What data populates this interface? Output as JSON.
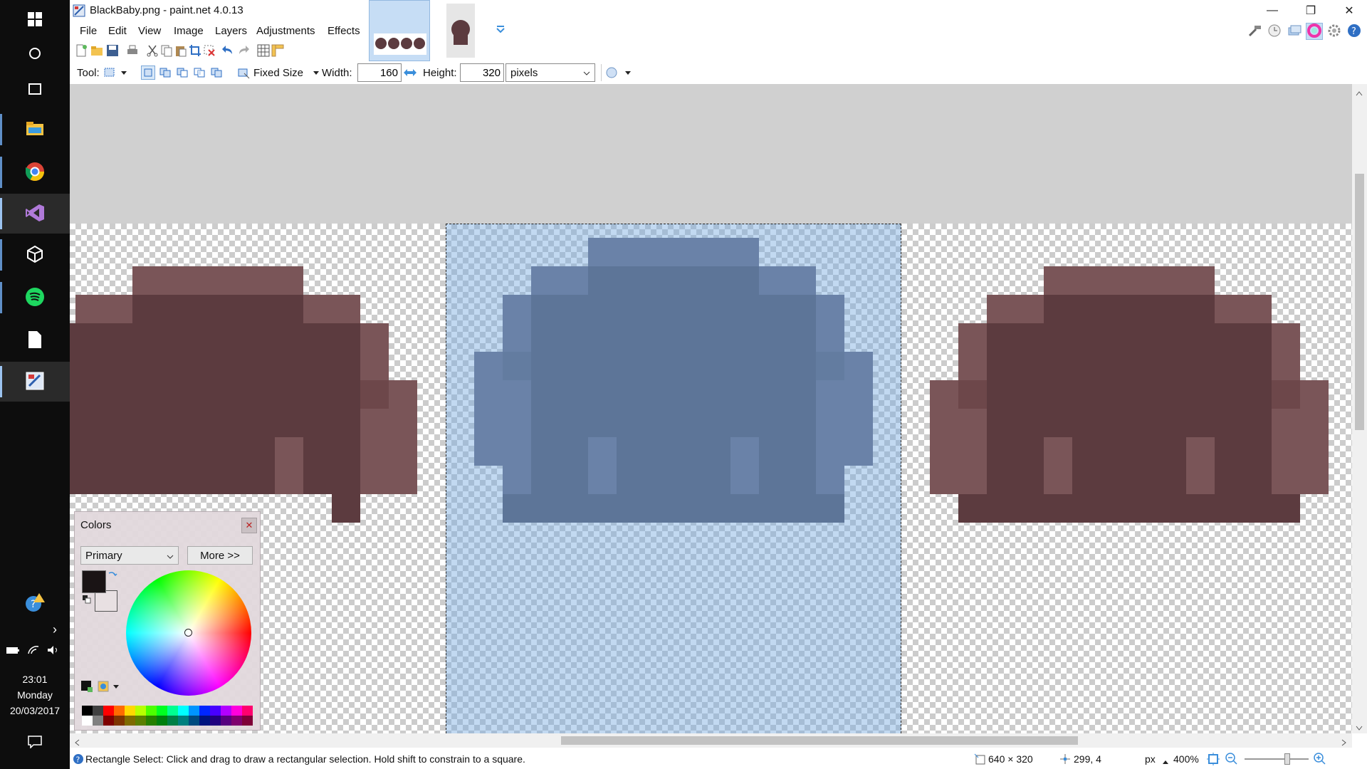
{
  "taskbar": {
    "items": [
      {
        "name": "windows-start",
        "icon": "windows-logo-icon"
      },
      {
        "name": "cortana",
        "icon": "cortana-circle-icon"
      },
      {
        "name": "task-view",
        "icon": "task-view-icon"
      },
      {
        "name": "file-explorer",
        "icon": "folder-icon"
      },
      {
        "name": "chrome",
        "icon": "chrome-icon"
      },
      {
        "name": "visual-studio",
        "icon": "visual-studio-icon"
      },
      {
        "name": "unity",
        "icon": "unity-icon"
      },
      {
        "name": "spotify",
        "icon": "spotify-icon"
      },
      {
        "name": "notepad",
        "icon": "document-icon"
      },
      {
        "name": "paint-net",
        "icon": "paint-net-icon"
      }
    ],
    "time": "23:01",
    "day": "Monday",
    "date": "20/03/2017"
  },
  "window": {
    "title": "BlackBaby.png - paint.net 4.0.13"
  },
  "menu": [
    "File",
    "Edit",
    "View",
    "Image",
    "Layers",
    "Adjustments",
    "Effects"
  ],
  "tool_options": {
    "tool_label": "Tool:",
    "fixed_size": "Fixed Size",
    "width_label": "Width:",
    "width_value": "160",
    "height_label": "Height:",
    "height_value": "320",
    "units": "pixels"
  },
  "colors_panel": {
    "title": "Colors",
    "mode": "Primary",
    "more_button": "More >>",
    "primary_color": "#1a1415",
    "secondary_color": "#e8e0e2"
  },
  "status": {
    "hint": "Rectangle Select: Click and drag to draw a rectangular selection. Hold shift to constrain to a square.",
    "image_size": "640 × 320",
    "cursor_pos": "299, 4",
    "unit": "px",
    "zoom": "400%"
  },
  "colors": {
    "brown_dark": "#5c3b3f",
    "brown_light": "#7a5558",
    "slate_dark": "#474a5e",
    "slate_light": "#60627a"
  }
}
